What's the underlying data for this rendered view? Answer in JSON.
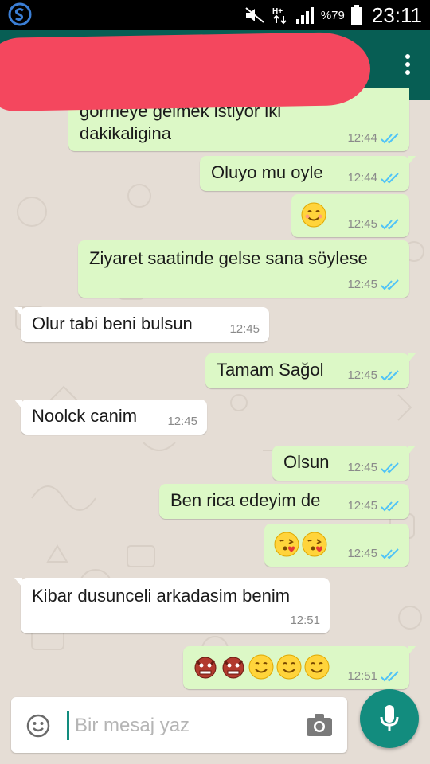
{
  "status_bar": {
    "battery_percent": "%79",
    "time": "23:11",
    "network": "H+"
  },
  "header": {
    "title_redacted": true,
    "accent": "#075e54",
    "redaction_color": "#f4475e"
  },
  "messages": [
    {
      "dir": "out",
      "text_lines": [
        "görmeye gelmek istiyor iki",
        "dakikaligina"
      ],
      "time": "12:44",
      "read": true
    },
    {
      "dir": "out",
      "text": "Oluyo mu oyle",
      "time": "12:44",
      "read": true
    },
    {
      "dir": "out",
      "emojis": [
        "smiling-face"
      ],
      "time": "12:45",
      "read": true
    },
    {
      "dir": "out",
      "text": "Ziyaret saatinde gelse sana söylese",
      "time": "12:45",
      "read": true
    },
    {
      "dir": "in",
      "text": "Olur tabi beni bulsun",
      "time": "12:45"
    },
    {
      "dir": "out",
      "text": "Tamam Sağol",
      "time": "12:45",
      "read": true
    },
    {
      "dir": "in",
      "text": "Noolck canim",
      "time": "12:45"
    },
    {
      "dir": "out",
      "text": "Olsun",
      "time": "12:45",
      "read": true
    },
    {
      "dir": "out",
      "text": "Ben rica edeyim de",
      "time": "12:45",
      "read": true
    },
    {
      "dir": "out",
      "emojis": [
        "face-blowing-kiss",
        "face-blowing-kiss"
      ],
      "time": "12:45",
      "read": true
    },
    {
      "dir": "in",
      "text": "Kibar dusunceli arkadasim benim",
      "time": "12:51"
    },
    {
      "dir": "out",
      "emojis": [
        "ogre-face",
        "ogre-face",
        "smiling-face",
        "smiling-face",
        "smiling-face"
      ],
      "time": "12:51",
      "read": true
    }
  ],
  "composer": {
    "placeholder": "Bir mesaj yaz",
    "value": ""
  },
  "colors": {
    "outgoing_bubble": "#dcf8c6",
    "incoming_bubble": "#ffffff",
    "read_ticks": "#4fc3f7",
    "fab": "#128c7e"
  }
}
